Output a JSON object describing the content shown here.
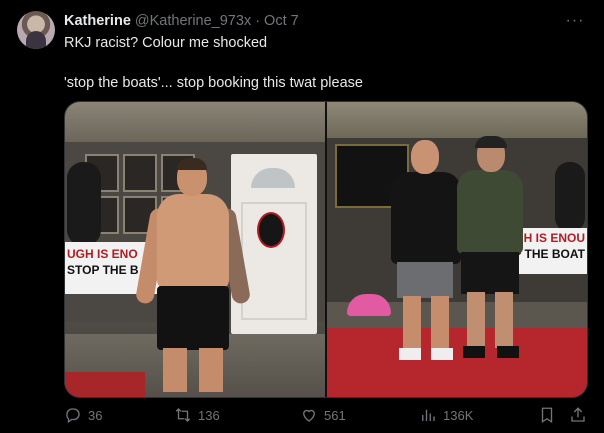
{
  "tweet": {
    "author_name": "Katherine",
    "handle": "@Katherine_973x",
    "separator": "·",
    "date": "Oct 7",
    "more_label": "···",
    "text_line1": "RKJ racist? Colour me shocked",
    "text_line2": "'stop the boats'... stop booking this twat please"
  },
  "media": {
    "left_banner_line1": "UGH IS ENO",
    "left_banner_line2": "STOP THE B",
    "right_banner_line1": "UGH IS ENOU",
    "right_banner_line2": "P THE BOAT"
  },
  "actions": {
    "replies": "36",
    "retweets": "136",
    "likes": "561",
    "views": "136K"
  },
  "icons": {
    "reply": "reply-icon",
    "retweet": "retweet-icon",
    "like": "heart-icon",
    "views": "views-chart-icon",
    "bookmark": "bookmark-icon",
    "share": "share-icon"
  },
  "colors": {
    "background": "#000000",
    "text_primary": "#e7e9ea",
    "text_secondary": "#71767b",
    "border": "#2f3336"
  }
}
